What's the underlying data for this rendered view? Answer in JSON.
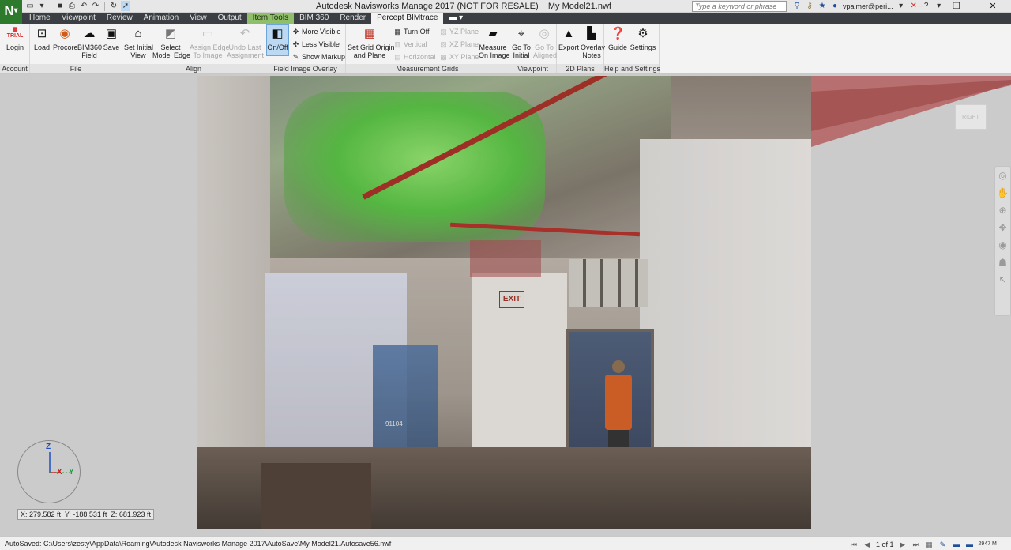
{
  "app": {
    "logo_text": "N",
    "window_title": "Autodesk Navisworks Manage 2017 (NOT FOR RESALE)    My Model21.nwf",
    "search_placeholder": "Type a keyword or phrase",
    "user": "vpalmer@peri...",
    "quick_access_icons": [
      "open-file-icon",
      "save-icon",
      "print-icon",
      "undo-icon",
      "redo-icon",
      "refresh-icon",
      "select-cursor-icon"
    ],
    "title_icons": [
      "binoculars-icon",
      "key-icon",
      "star-icon",
      "user-icon",
      "exchange-icon",
      "help-icon"
    ]
  },
  "tabs": [
    {
      "label": "Home"
    },
    {
      "label": "Viewpoint"
    },
    {
      "label": "Review"
    },
    {
      "label": "Animation"
    },
    {
      "label": "View"
    },
    {
      "label": "Output"
    },
    {
      "label": "Item Tools"
    },
    {
      "label": "BIM 360"
    },
    {
      "label": "Render"
    },
    {
      "label": "Percept BIMtrace"
    }
  ],
  "ribbon": {
    "panels": {
      "account": "Account",
      "file": "File",
      "align": "Align",
      "overlay": "Field Image Overlay",
      "grids": "Measurement Grids",
      "viewpoint": "Viewpoint",
      "plans": "2D Plans",
      "help": "Help and Settings"
    },
    "login": {
      "icon_text": "TRIAL",
      "label": "Login"
    },
    "load": "Load",
    "procore": "Procore",
    "bim360_field": {
      "line1": "BIM360",
      "line2": "Field"
    },
    "save": "Save",
    "set_initial_view": {
      "line1": "Set Initial",
      "line2": "View"
    },
    "select_model_edge": {
      "line1": "Select",
      "line2": "Model Edge"
    },
    "assign_edge": {
      "line1": "Assign Edge",
      "line2": "To Image"
    },
    "undo_last": {
      "line1": "Undo Last",
      "line2": "Assignment"
    },
    "on_off": "On/Off",
    "more_visible": "More Visible",
    "less_visible": "Less Visible",
    "show_markup": "Show Markup",
    "set_grid_origin": {
      "line1": "Set Grid Origin",
      "line2": "and Plane"
    },
    "turn_off": "Turn Off",
    "vertical": "Vertical",
    "horizontal": "Horizontal",
    "yz_plane": "YZ Plane",
    "xz_plane": "XZ Plane",
    "xy_plane": "XY Plane",
    "measure_on_image": {
      "line1": "Measure",
      "line2": "On Image"
    },
    "go_to_initial": {
      "line1": "Go To",
      "line2": "Initial"
    },
    "go_to_aligned": {
      "line1": "Go To",
      "line2": "Aligned"
    },
    "export": "Export",
    "overlay_notes": {
      "line1": "Overlay",
      "line2": "Notes"
    },
    "guide": "Guide",
    "settings": "Settings"
  },
  "viewport": {
    "exit_sign": "EXIT",
    "lift_label": "91104",
    "viewcube_label": "RIGHT",
    "axis": {
      "z": "Z",
      "x": "X",
      "y": "Y"
    },
    "coordinates": "X: 279.582 ft  Y: -188.531 ft  Z: 681.923 ft",
    "nav_icons": [
      "steering-wheel-icon",
      "pan-icon",
      "zoom-icon",
      "orbit-icon",
      "look-icon",
      "walk-icon",
      "select-icon"
    ]
  },
  "statusbar": {
    "autosaved": "AutoSaved: C:\\Users\\zesty\\AppData\\Roaming\\Autodesk Navisworks Manage 2017\\AutoSave\\My Model21.Autosave56.nwf",
    "page": "1 of 1",
    "memory": "2947 M"
  }
}
